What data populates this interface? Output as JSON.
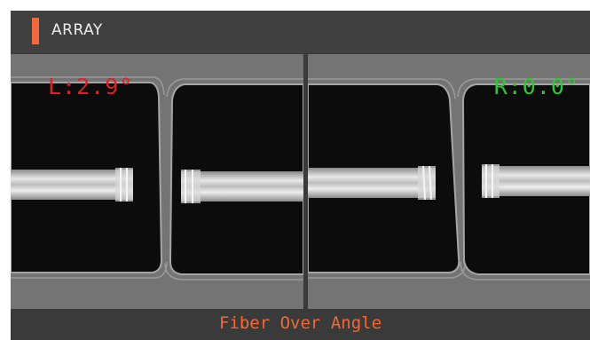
{
  "header": {
    "title": "ARRAY",
    "accent_color": "#f06a3c"
  },
  "views": {
    "left": {
      "angle_label": "L:2.9°",
      "label_color": "#d4242a"
    },
    "right": {
      "angle_label": "R:0.0°",
      "label_color": "#36c33c"
    }
  },
  "status": {
    "message": "Fiber Over Angle",
    "color": "#f06a3c"
  }
}
